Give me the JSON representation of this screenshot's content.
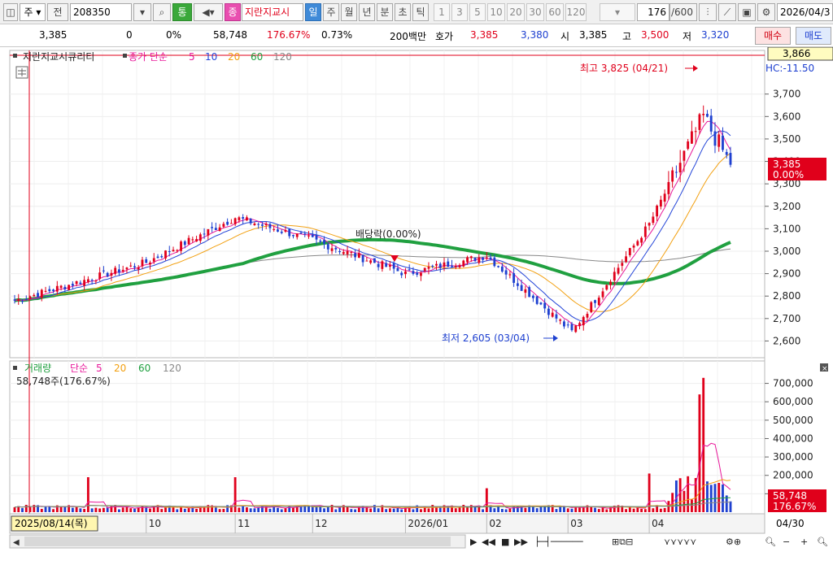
{
  "toolbar": {
    "type_label": "주",
    "prefix_label": "전",
    "code": "208350",
    "tong_label": "통",
    "jong_label": "종",
    "stock_name": "지란지교시",
    "period_tabs": [
      "일",
      "주",
      "월",
      "년",
      "분",
      "초",
      "틱"
    ],
    "active_period": "일",
    "intervals": [
      "1",
      "3",
      "5",
      "10",
      "20",
      "30",
      "60",
      "120"
    ],
    "count_display": "176",
    "count_total": "/600",
    "date_field": "2026/04/3"
  },
  "quote": {
    "price": "3,385",
    "change": "0",
    "change_pct": "0%",
    "volume": "58,748",
    "volume_ratio": "176.67%",
    "turnover_pct": "0.73%",
    "unit": "200백만",
    "ask_label": "호가",
    "ask_price": "3,385",
    "bid_price": "3,380",
    "open_label": "시",
    "open": "3,385",
    "high_label": "고",
    "high": "3,500",
    "low_label": "저",
    "low": "3,320",
    "buy_label": "매수",
    "sell_label": "매도"
  },
  "price_panel": {
    "legend_name": "지란지교시큐리티",
    "legend_ma": "종가 단순",
    "ma_periods": [
      "5",
      "10",
      "20",
      "60",
      "120"
    ],
    "ma_colors": [
      "#e8189a",
      "#2445d8",
      "#f2a011",
      "#20a040",
      "#888888"
    ],
    "crosshair_price": "3,866",
    "hc_label": "HC:-11.50",
    "high_annotation": "최고 3,825 (04/21)",
    "low_annotation": "최저 2,605 (03/04)",
    "dividend_annotation": "배당락(0.00%)",
    "current_price": "3,385",
    "current_pct": "0.00%",
    "y_ticks": [
      "3,700",
      "3,600",
      "3,500",
      "3,400",
      "3,300",
      "3,200",
      "3,100",
      "3,000",
      "2,900",
      "2,800",
      "2,700",
      "2,600"
    ]
  },
  "volume_panel": {
    "legend_name": "거래량",
    "legend_ma": "단순",
    "ma_periods": [
      "5",
      "20",
      "60",
      "120"
    ],
    "ma_colors": [
      "#e8189a",
      "#f2a011",
      "#20a040",
      "#888888"
    ],
    "subtitle": "58,748주(176.67%)",
    "current_volume": "58,748",
    "current_pct": "176.67%",
    "y_ticks": [
      "700,000",
      "600,000",
      "500,000",
      "400,000",
      "300,000",
      "200,000",
      "100,000"
    ]
  },
  "x_axis": {
    "cursor_date": "2025/08/14(목)",
    "month_labels": [
      "10",
      "11",
      "12",
      "2026/01",
      "02",
      "03",
      "04"
    ],
    "end_label": "04/30"
  },
  "chart_data": [
    {
      "type": "candlestick",
      "title": "지란지교시큐리티",
      "ylim": [
        2540,
        3880
      ],
      "summary_points": [
        {
          "date": "2025/08/14",
          "close": 2780
        },
        {
          "date": "2025/10/01",
          "close": 2950
        },
        {
          "date": "2025/11/03",
          "close": 3150
        },
        {
          "date": "2025/12/01",
          "close": 3050
        },
        {
          "date": "2026/01/02",
          "close": 2900
        },
        {
          "date": "2026/02/02",
          "close": 2980
        },
        {
          "date": "2026/03/04",
          "close": 2640
        },
        {
          "date": "2026/04/01",
          "close": 3120
        },
        {
          "date": "2026/04/21",
          "close": 3600
        },
        {
          "date": "2026/04/30",
          "close": 3385
        }
      ],
      "high": {
        "value": 3825,
        "date": "04/21"
      },
      "low": {
        "value": 2605,
        "date": "03/04"
      }
    },
    {
      "type": "bar",
      "title": "거래량",
      "ylim": [
        0,
        760000
      ],
      "summary_points": [
        {
          "date": "2025/09/10",
          "value": 190000
        },
        {
          "date": "2025/11/03",
          "value": 190000
        },
        {
          "date": "2026/02/02",
          "value": 130000
        },
        {
          "date": "2026/04/01",
          "value": 210000
        },
        {
          "date": "2026/04/20",
          "value": 640000
        },
        {
          "date": "2026/04/21",
          "value": 730000
        },
        {
          "date": "2026/04/30",
          "value": 58748
        }
      ]
    }
  ]
}
